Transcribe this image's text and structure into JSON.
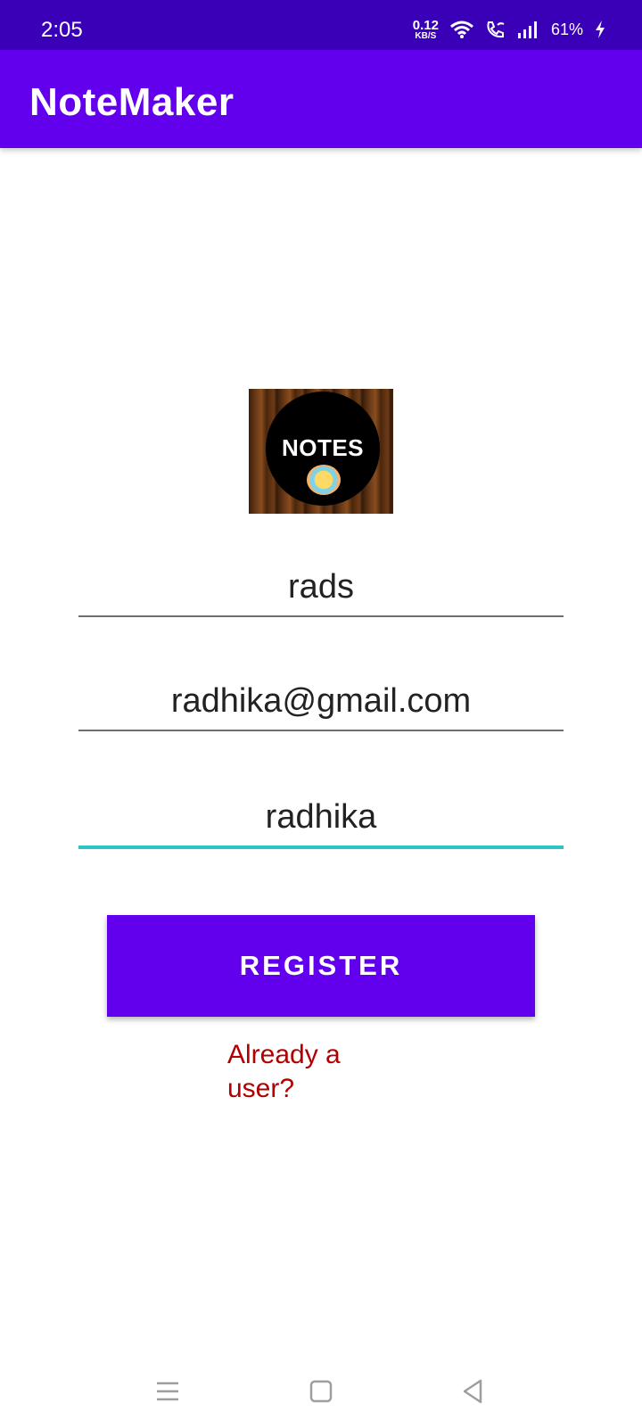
{
  "status_bar": {
    "time": "2:05",
    "net_speed_value": "0.12",
    "net_speed_unit": "KB/S",
    "battery": "61%",
    "icons": [
      "wifi-icon",
      "wifi-calling-icon",
      "signal-icon",
      "charging-icon"
    ]
  },
  "app_bar": {
    "title": "NoteMaker"
  },
  "logo": {
    "text": "NOTES"
  },
  "form": {
    "username": "rads",
    "email": "radhika@gmail.com",
    "password": "radhika"
  },
  "register_label": "REGISTER",
  "login_link": "Already a user?",
  "nav": {
    "icons": [
      "menu-icon",
      "home-icon",
      "back-icon"
    ]
  },
  "colors": {
    "status_bar": "#3a00b8",
    "primary": "#6200ee",
    "focus_underline": "#2ec4c4",
    "link": "#b00000"
  }
}
